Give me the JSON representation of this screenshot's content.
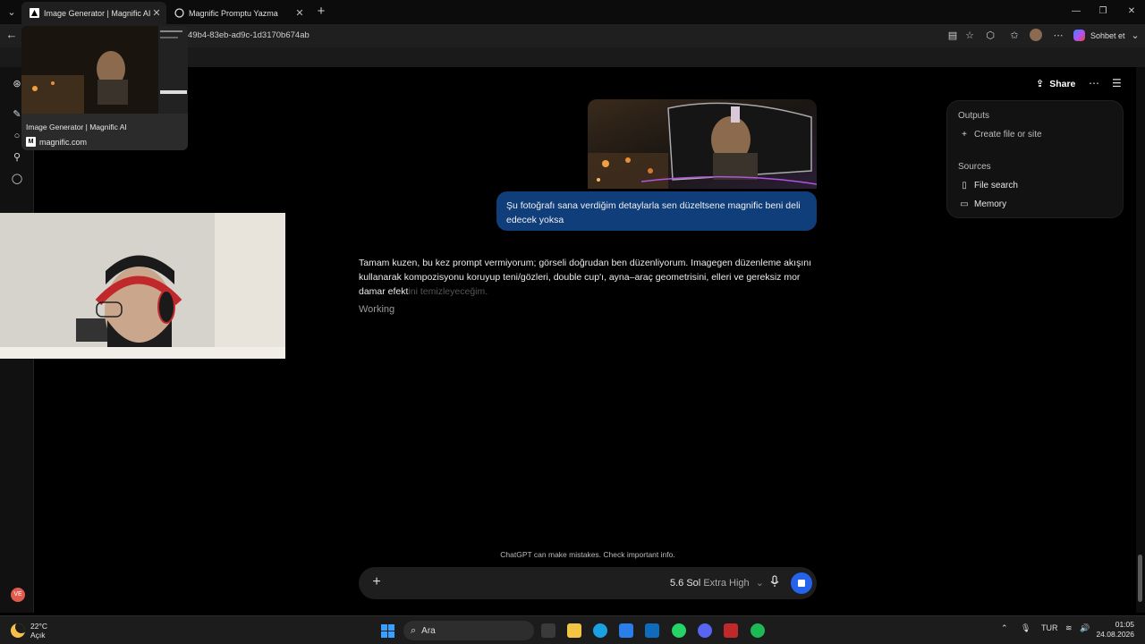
{
  "browser": {
    "tabs": [
      {
        "title": "Image Generator | Magnific AI",
        "active": true
      },
      {
        "title": "Magnific Promptu Yazma",
        "active": false
      }
    ],
    "url": "49b4-83eb-ad9c-1d3170b674ab",
    "sohbet_label": "Sohbet et"
  },
  "tab_preview": {
    "title": "Image Generator | Magnific AI",
    "host": "magnific.com"
  },
  "header": {
    "share_label": "Share"
  },
  "conversation": {
    "user_message": "Şu fotoğrafı sana verdiğim detaylarla sen düzeltsene magnific beni deli edecek yoksa",
    "assistant_text": "Tamam kuzen, bu kez prompt vermiyorum; görseli doğrudan ben düzenliyorum. Imagegen düzenleme akışını kullanarak kompozisyonu koruyup teni/gözleri, double cup'ı, ayna–araç geometrisini, elleri ve gereksiz mor damar efekt",
    "assistant_text_fading": "ini temizleyeceğim.",
    "status": "Working"
  },
  "side_panel": {
    "outputs_heading": "Outputs",
    "create_label": "Create file or site",
    "sources_heading": "Sources",
    "sources": [
      "File search",
      "Memory"
    ]
  },
  "composer": {
    "model": "5.6 Sol",
    "effort": "Extra High",
    "disclaimer": "ChatGPT can make mistakes. Check important info."
  },
  "taskbar": {
    "temperature": "22°C",
    "condition": "Açık",
    "search_placeholder": "Ara",
    "language": "TUR",
    "time": "01:05",
    "date": "24.08.2026"
  },
  "rail": {
    "avatar_initials": "VE"
  },
  "colors": {
    "accent": "#2563eb",
    "user_bubble": "#0f3e7a"
  }
}
